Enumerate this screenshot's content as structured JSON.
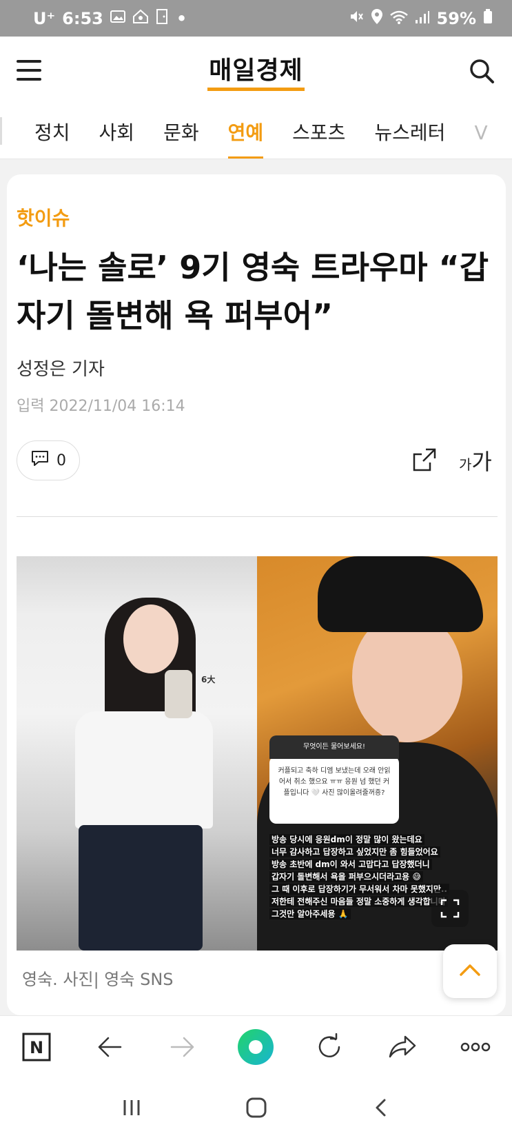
{
  "status_bar": {
    "carrier": "U⁺",
    "time": "6:53",
    "battery": "59%",
    "left_icons": [
      "image-icon",
      "home-icon",
      "door-icon",
      "dot-icon"
    ],
    "right_icons": [
      "mute-icon",
      "location-icon",
      "wifi-icon",
      "signal-icon",
      "battery-icon"
    ]
  },
  "header": {
    "logo": "매일경제",
    "menu_icon": "hamburger-icon",
    "search_icon": "search-icon"
  },
  "nav": {
    "tabs": [
      {
        "label": "정치"
      },
      {
        "label": "사회"
      },
      {
        "label": "문화"
      },
      {
        "label": "연예",
        "active": true
      },
      {
        "label": "스포츠"
      },
      {
        "label": "뉴스레터"
      },
      {
        "label": "V"
      }
    ]
  },
  "article": {
    "kicker": "핫이슈",
    "title": "‘나는 솔로’ 9기 영숙 트라우마 “갑자기 돌변해 욕 퍼부어”",
    "byline": "성정은 기자",
    "date_label": "입력",
    "date": "2022/11/04 16:14",
    "comment_count": "0",
    "font_size_small": "가",
    "font_size_large": "가",
    "image_caption": "영숙. 사진| 영숙 SNS",
    "photo": {
      "question_header": "무엇이든 물어보세요!",
      "question_text": "커플되고 축하 디엠 보냈는데 오래 안읽어서 취소 했으요 ㅠㅠ 응원 넘 했던 커플입니다 🤍 사진 많이올려줄꺼죵?",
      "answer_lines": [
        "방송 당시에 응원dm이 정말 많이 왔는데요",
        "너무 감사하고 답장하고 싶었지만 좀 힘들었어요",
        "방송 초반에 dm이 와서 고맙다고 답장했더니",
        "갑자기 돌변해서 욕을 퍼부으시더라고용 😅",
        "그 때 이후로 답장하기가 무서워서 차마 못했지만..",
        "저한테 전해주신 마음들 정말 소중하게 생각합니다",
        "그것만 알아주세용 🙏"
      ],
      "sign_text": "6大"
    }
  },
  "toolbar": {
    "items": [
      "naver-n-icon",
      "back-arrow-icon",
      "forward-arrow-icon",
      "green-dot-icon",
      "refresh-icon",
      "share-arrow-icon",
      "more-icon"
    ],
    "naver_label": "N"
  },
  "colors": {
    "accent": "#f39c12",
    "status_bar": "#9a9a9a",
    "green": "#19c77a"
  }
}
